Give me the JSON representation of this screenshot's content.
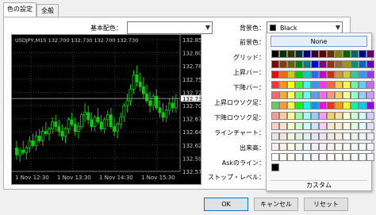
{
  "tabs": [
    "色の設定",
    "全般"
  ],
  "basic_scheme": {
    "label": "基本配色：",
    "value": ""
  },
  "chart": {
    "title": "USDJPY,M15",
    "ohlc_text": "132.700 132.730 132.700 132.730",
    "price_labels": [
      "132.855",
      "132.805",
      "132.780",
      "132.750",
      "132.725",
      "132.700",
      "132.670",
      "132.645",
      "132.620",
      "132.590",
      "132.575"
    ],
    "current_price": "132.730",
    "time_labels": [
      "1 Nov 12:30",
      "1 Nov 13:30",
      "1 Nov 14:30",
      "1 Nov 15:30"
    ],
    "candles": [
      [
        132.625,
        132.64,
        132.6,
        132.61
      ],
      [
        132.61,
        132.625,
        132.595,
        132.62
      ],
      [
        132.62,
        132.64,
        132.61,
        132.615
      ],
      [
        132.615,
        132.63,
        132.6,
        132.625
      ],
      [
        132.625,
        132.65,
        132.615,
        132.64
      ],
      [
        132.64,
        132.655,
        132.625,
        132.63
      ],
      [
        132.63,
        132.66,
        132.62,
        132.65
      ],
      [
        132.65,
        132.665,
        132.635,
        132.64
      ],
      [
        132.64,
        132.67,
        132.63,
        132.66
      ],
      [
        132.66,
        132.68,
        132.65,
        132.655
      ],
      [
        132.655,
        132.67,
        132.64,
        132.665
      ],
      [
        132.665,
        132.69,
        132.655,
        132.68
      ],
      [
        132.68,
        132.695,
        132.66,
        132.67
      ],
      [
        132.67,
        132.685,
        132.65,
        132.66
      ],
      [
        132.66,
        132.675,
        132.64,
        132.65
      ],
      [
        132.65,
        132.67,
        132.635,
        132.665
      ],
      [
        132.665,
        132.69,
        132.655,
        132.685
      ],
      [
        132.685,
        132.7,
        132.67,
        132.675
      ],
      [
        132.675,
        132.69,
        132.65,
        132.66
      ],
      [
        132.66,
        132.68,
        132.645,
        132.67
      ],
      [
        132.67,
        132.7,
        132.665,
        132.695
      ],
      [
        132.695,
        132.72,
        132.68,
        132.7
      ],
      [
        132.7,
        132.715,
        132.675,
        132.685
      ],
      [
        132.685,
        132.7,
        132.66,
        132.67
      ],
      [
        132.67,
        132.695,
        132.66,
        132.69
      ],
      [
        132.69,
        132.71,
        132.675,
        132.68
      ],
      [
        132.68,
        132.695,
        132.66,
        132.665
      ],
      [
        132.665,
        132.69,
        132.655,
        132.685
      ],
      [
        132.685,
        132.705,
        132.67,
        132.695
      ],
      [
        132.695,
        132.71,
        132.665,
        132.67
      ],
      [
        132.67,
        132.69,
        132.65,
        132.66
      ],
      [
        132.66,
        132.68,
        132.645,
        132.675
      ],
      [
        132.675,
        132.7,
        132.665,
        132.69
      ],
      [
        132.69,
        132.72,
        132.68,
        132.715
      ],
      [
        132.715,
        132.74,
        132.7,
        132.725
      ],
      [
        132.725,
        132.76,
        132.715,
        132.75
      ],
      [
        132.75,
        132.79,
        132.74,
        132.78
      ],
      [
        132.78,
        132.8,
        132.755,
        132.765
      ],
      [
        132.765,
        132.785,
        132.745,
        132.755
      ],
      [
        132.755,
        132.775,
        132.73,
        132.74
      ],
      [
        132.74,
        132.76,
        132.72,
        132.725
      ],
      [
        132.725,
        132.745,
        132.7,
        132.715
      ],
      [
        132.715,
        132.74,
        132.705,
        132.735
      ],
      [
        132.735,
        132.75,
        132.705,
        132.71
      ],
      [
        132.71,
        132.725,
        132.69,
        132.7
      ],
      [
        132.7,
        132.72,
        132.68,
        132.69
      ],
      [
        132.69,
        132.715,
        132.68,
        132.705
      ],
      [
        132.705,
        132.73,
        132.695,
        132.72
      ],
      [
        132.72,
        132.735,
        132.7,
        132.71
      ],
      [
        132.71,
        132.74,
        132.7,
        132.73
      ]
    ]
  },
  "settings": {
    "background": {
      "label": "背景色：",
      "value": "Black",
      "color": "#000000"
    },
    "foreground": {
      "label": "前景色："
    },
    "grid": {
      "label": "グリッド："
    },
    "bull_bar": {
      "label": "上昇バー："
    },
    "bear_bar": {
      "label": "下降バー："
    },
    "bull_candle": {
      "label": "上昇ロウソク足："
    },
    "bear_candle": {
      "label": "下降ロウソク足："
    },
    "line_chart": {
      "label": "ラインチャート："
    },
    "volume": {
      "label": "出来高："
    },
    "ask_line": {
      "label": "Askのライン："
    },
    "stop_level": {
      "label": "ストップ・レベル："
    }
  },
  "color_picker": {
    "none_label": "None",
    "custom_label": "カスタム",
    "swatches": [
      [
        "#000000",
        "#003300",
        "#333300",
        "#003333",
        "#000080",
        "#330033",
        "#660000",
        "#663300",
        "#808000",
        "#006600",
        "#006666",
        "#000099",
        "#660066"
      ],
      [
        "#800000",
        "#804000",
        "#666600",
        "#008000",
        "#008080",
        "#0000ff",
        "#800080",
        "#993300",
        "#996633",
        "#999900",
        "#009966",
        "#0066cc",
        "#6600cc"
      ],
      [
        "#ff0000",
        "#ff6600",
        "#cccc00",
        "#00cc00",
        "#00cccc",
        "#3366ff",
        "#cc00cc",
        "#cc3300",
        "#cc9933",
        "#cccc33",
        "#33cc99",
        "#3399ff",
        "#9933ff"
      ],
      [
        "#ff3333",
        "#ff9900",
        "#ffff00",
        "#33ff33",
        "#33ffff",
        "#3399ff",
        "#ff33ff",
        "#ff6633",
        "#ffcc33",
        "#ffff33",
        "#66ff99",
        "#66ccff",
        "#cc66ff"
      ],
      [
        "#ff6666",
        "#ffaa33",
        "#ffff66",
        "#66ff66",
        "#66ffff",
        "#6699ff",
        "#ff66ff",
        "#ff9966",
        "#ffcc66",
        "#ffff99",
        "#99ffcc",
        "#99ccff",
        "#cc99ff"
      ],
      [
        "#66cc66",
        "#ff9933",
        "#ffff33",
        "#00ff00",
        "#00ffff",
        "#0099ff",
        "#ff00ff",
        "#ff3300",
        "#ff9900",
        "#ffff00",
        "#00ff99",
        "#00ccff",
        "#9900ff"
      ],
      [
        "#ff9999",
        "#ffcc99",
        "#ffff99",
        "#99ff99",
        "#99ffff",
        "#99ccff",
        "#ff99ff",
        "#ffcc66",
        "#ffdd99",
        "#ffffcc",
        "#ccffcc",
        "#ccffff",
        "#ccccff"
      ],
      [
        "#ffcccc",
        "#ffe0cc",
        "#ffffcc",
        "#ccffcc",
        "#ccffff",
        "#cce5ff",
        "#ffccff",
        "#ffe5cc",
        "#ffeecc",
        "#ffffe0",
        "#e0ffe0",
        "#e0ffff",
        "#e0e0ff"
      ],
      [
        "#e6e6e6",
        "#f0e6d8",
        "#f5f5dc",
        "#e0f0e0",
        "#e0f0f0",
        "#e0e8f5",
        "#f0e0f0",
        "#f5e6e0",
        "#f5ece0",
        "#fafaf0",
        "#eaf5ea",
        "#eaf5f5",
        "#ececf8"
      ],
      [
        "#f2f2f2",
        "#f7f0e8",
        "#fafaeb",
        "#eef7ee",
        "#eef7f7",
        "#eef2fa",
        "#f7eef7",
        "#faf0eb",
        "#faf5eb",
        "#fcfcf5",
        "#f3faf3",
        "#f3fafa",
        "#f4f4fc"
      ],
      [
        "#ffffff",
        "#fffaf5",
        "#fffff5",
        "#f5fff5",
        "#f5ffff",
        "#f5f8ff",
        "#fff5ff",
        "#fff8f5",
        "#fffbf5",
        "#fffffa",
        "#f8fff8",
        "#f8ffff",
        "#f8f8ff"
      ],
      [
        "#000000"
      ]
    ]
  },
  "buttons": {
    "ok": "OK",
    "cancel": "キャンセル",
    "reset": "リセット"
  }
}
